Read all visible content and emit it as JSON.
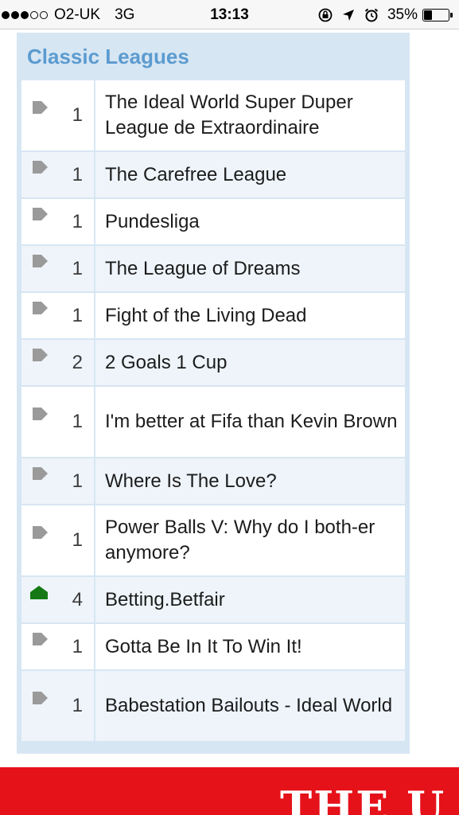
{
  "status_bar": {
    "signal_full": 3,
    "signal_total": 5,
    "carrier": "O2-UK",
    "network": "3G",
    "time": "13:13",
    "battery_percent_label": "35%",
    "battery_level": 0.35
  },
  "panel": {
    "title": "Classic Leagues",
    "title_color": "#5b9bd0",
    "leagues": [
      {
        "movement": "same",
        "rank": "1",
        "name": "The Ideal World Super Duper League de Extraordinaire"
      },
      {
        "movement": "same",
        "rank": "1",
        "name": "The Carefree League"
      },
      {
        "movement": "same",
        "rank": "1",
        "name": "Pundesliga"
      },
      {
        "movement": "same",
        "rank": "1",
        "name": "The League of Dreams"
      },
      {
        "movement": "same",
        "rank": "1",
        "name": "Fight of the Living Dead"
      },
      {
        "movement": "same",
        "rank": "2",
        "name": "2 Goals 1 Cup"
      },
      {
        "movement": "same",
        "rank": "1",
        "name": "I'm better at Fifa than Kevin Brown"
      },
      {
        "movement": "same",
        "rank": "1",
        "name": "Where Is The Love?"
      },
      {
        "movement": "same",
        "rank": "1",
        "name": "Power Balls V: Why do I both-er anymore?"
      },
      {
        "movement": "up",
        "rank": "4",
        "name": "Betting.Betfair"
      },
      {
        "movement": "same",
        "rank": "1",
        "name": "Gotta Be In It To Win It!"
      },
      {
        "movement": "same",
        "rank": "1",
        "name": "Babestation Bailouts - Ideal World"
      }
    ]
  },
  "colors": {
    "same_arrow": "#9a9a9a",
    "up_arrow": "#157a15",
    "banner": "#e5121a"
  },
  "banner": {
    "logo_text": "THE U"
  }
}
